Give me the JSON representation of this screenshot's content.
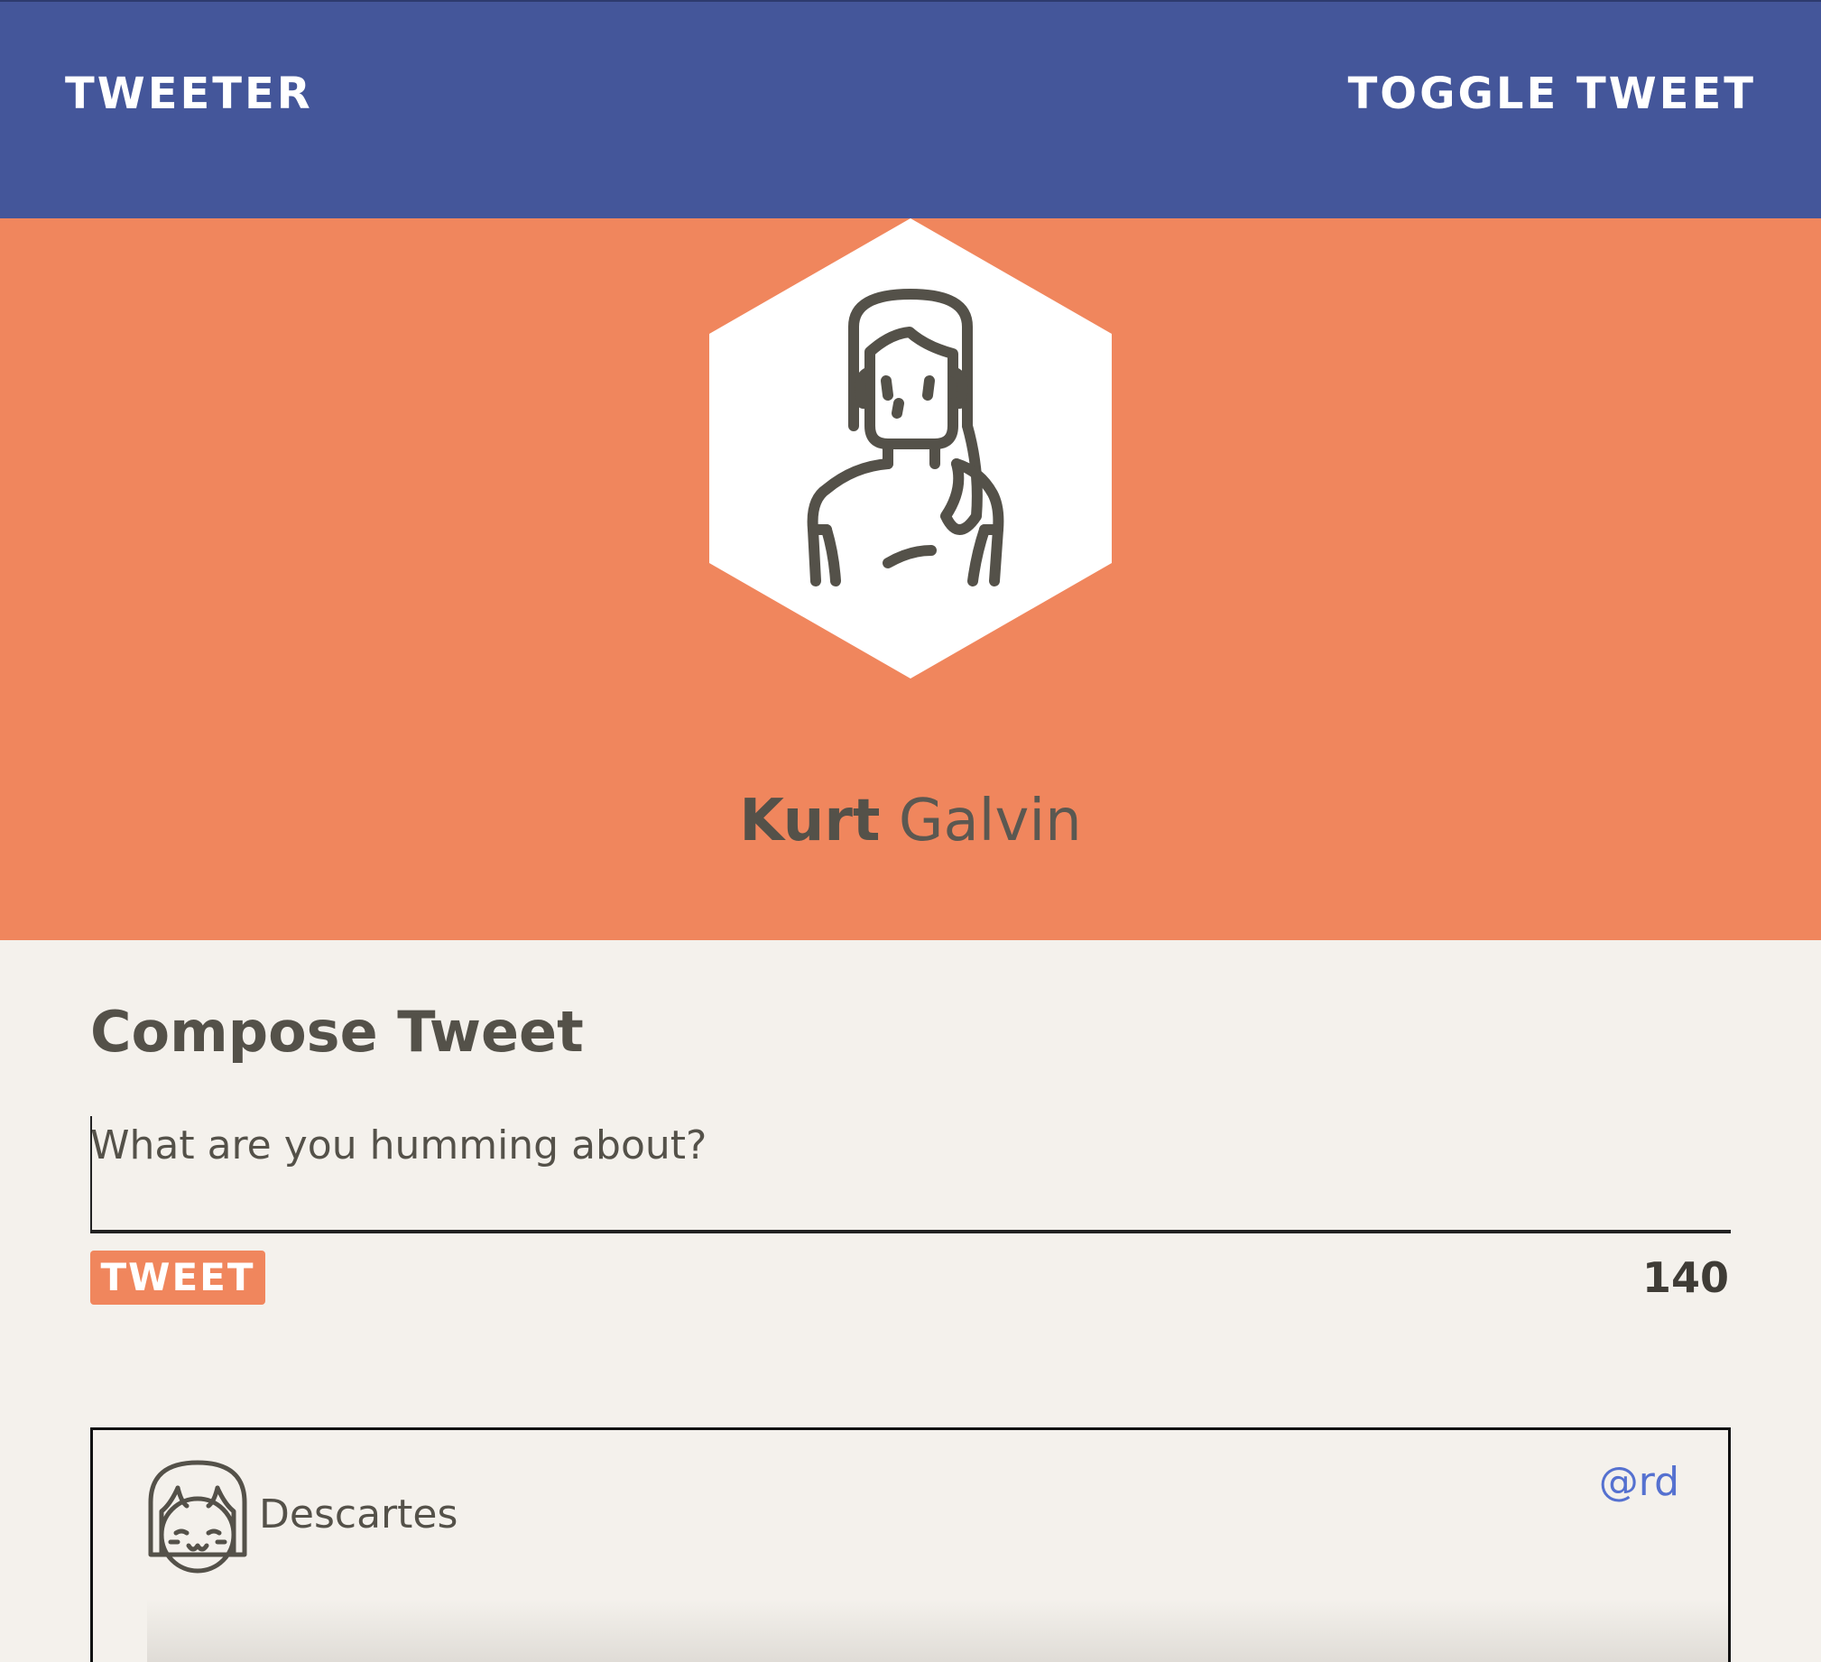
{
  "navbar": {
    "brand": "TWEETER",
    "toggle_label": "TOGGLE TWEET",
    "background": "#44569a"
  },
  "profile": {
    "first_name": "Kurt",
    "last_name": "Galvin",
    "avatar_icon": "woman-avatar-icon",
    "background": "#f0865d"
  },
  "compose": {
    "title": "Compose Tweet",
    "input_label": "What are you humming about?",
    "input_value": "",
    "tweet_button": "TWEET",
    "char_count": "140",
    "accent": "#f0865d"
  },
  "tweets": [
    {
      "author": "Descartes",
      "handle": "@rd",
      "avatar_icon": "girl-avatar-icon"
    }
  ]
}
